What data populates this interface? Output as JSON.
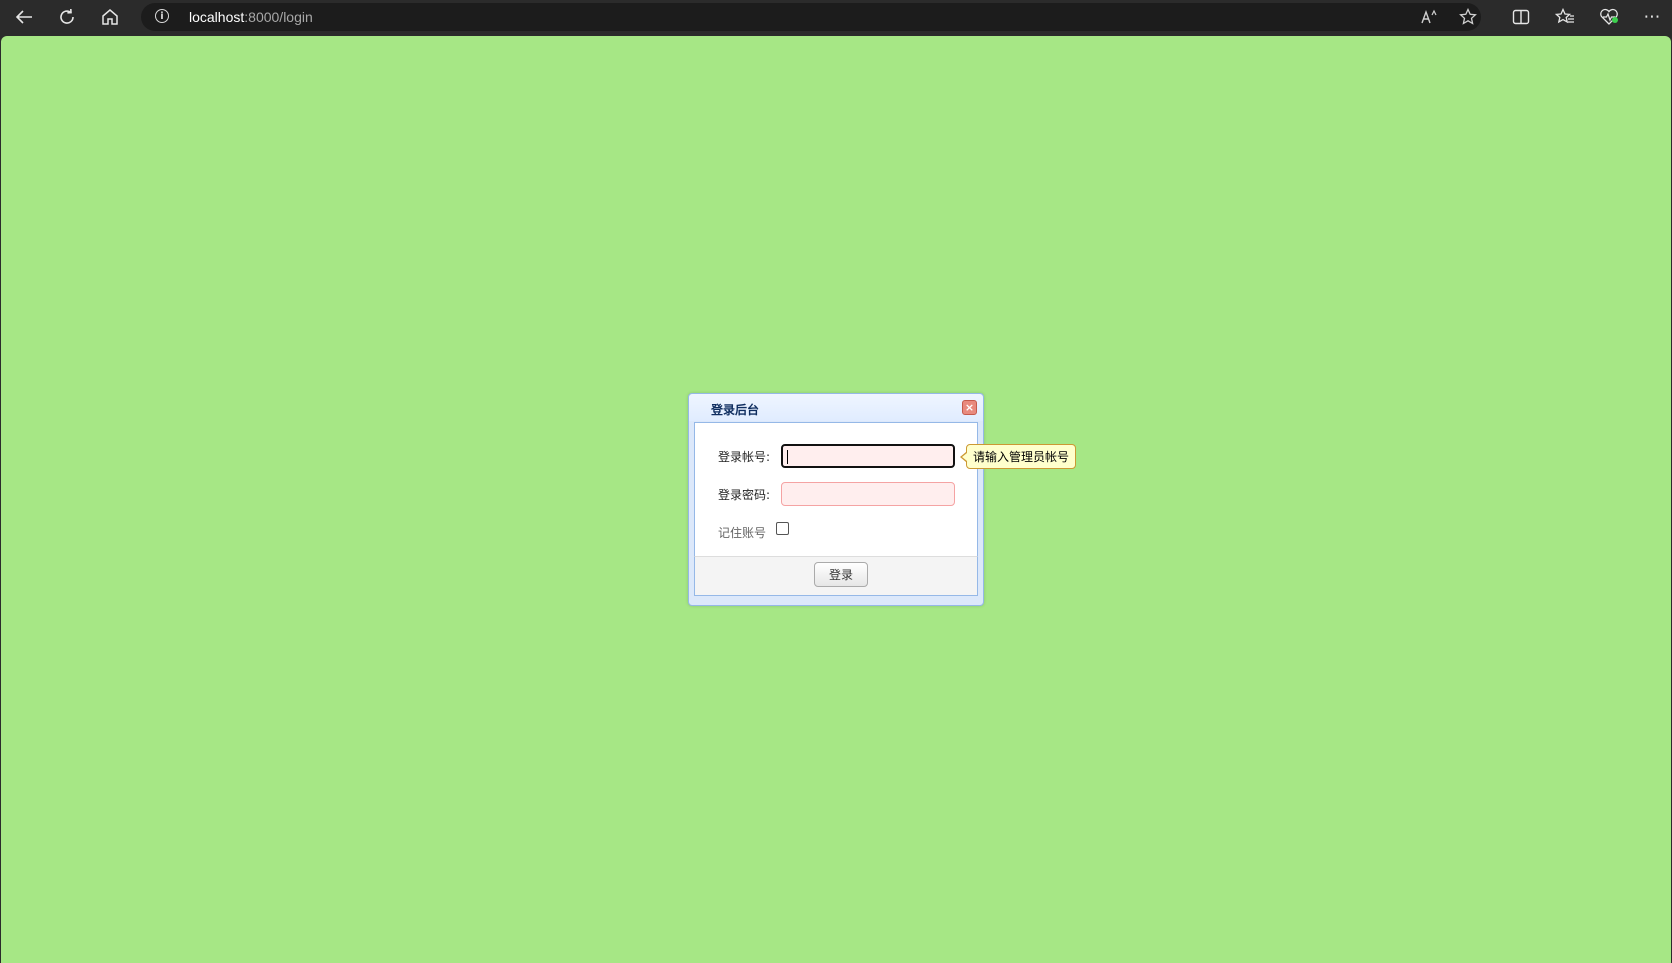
{
  "browser": {
    "address": {
      "host": "localhost",
      "path": ":8000/login"
    },
    "icons": {
      "back": "←",
      "refresh": "↻",
      "home": "⌂",
      "info": "i",
      "read_aloud": "A",
      "favorite": "☆",
      "split_screen": "▯",
      "favorites": "☆",
      "health": "♡",
      "more": "⋯"
    }
  },
  "dialog": {
    "title": "登录后台",
    "close_icon": "×",
    "account_label": "登录帐号:",
    "password_label": "登录密码:",
    "remember_label": "记住账号",
    "login_button": "登录",
    "tooltip": "请输入管理员帐号"
  },
  "colors": {
    "page_background": "#a6e785",
    "input_invalid_bg": "#ffeeee",
    "tooltip_bg": "#ffffcc"
  }
}
